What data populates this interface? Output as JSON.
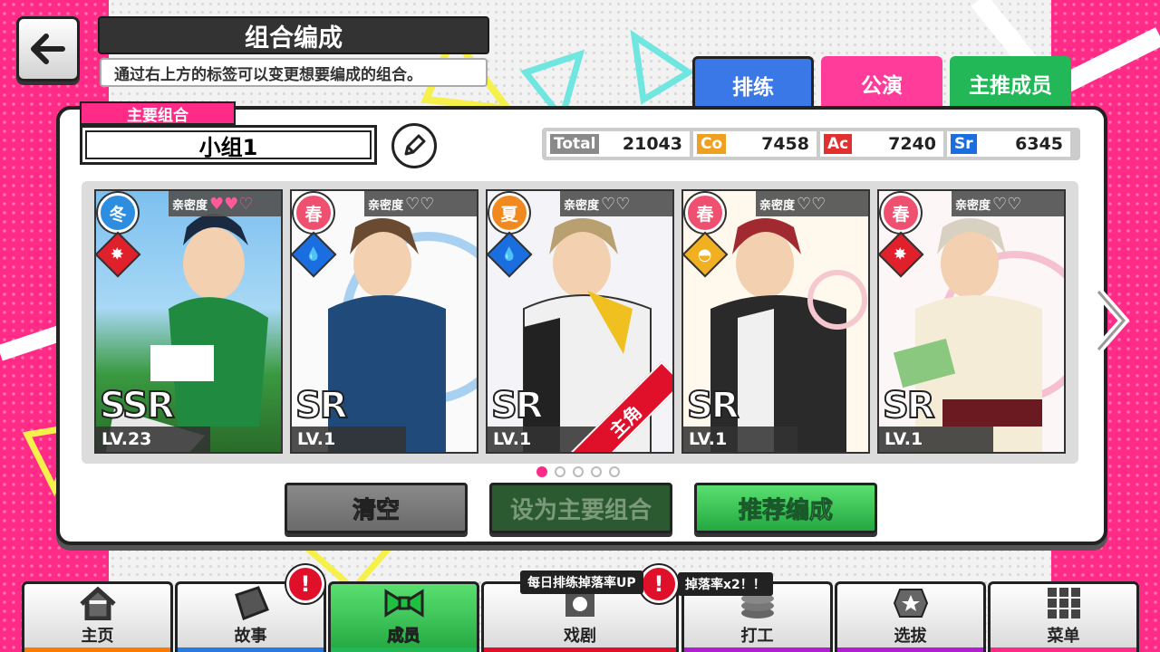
{
  "header": {
    "title": "组合编成",
    "subtitle": "通过右上方的标签可以变更想要编成的组合。"
  },
  "tabs": [
    {
      "label": "排练",
      "color": "#3a78e8"
    },
    {
      "label": "公演",
      "color": "#ff3c9a"
    },
    {
      "label": "主推成员",
      "color": "#22b857"
    }
  ],
  "group": {
    "section_label": "主要组合",
    "name": "小组1"
  },
  "stats": {
    "total_label": "Total",
    "total": "21043",
    "co_label": "Co",
    "co": "7458",
    "ac_label": "Ac",
    "ac": "7240",
    "sr_label": "Sr",
    "sr": "6345"
  },
  "affinity_label": "亲密度",
  "cards": [
    {
      "season": "冬",
      "season_color": "#2d8ee0",
      "attr": "✸",
      "attr_color": "#e0202a",
      "rarity": "SSR",
      "level": "LV.23",
      "hearts": "♥♥♡"
    },
    {
      "season": "春",
      "season_color": "#f05070",
      "attr": "💧",
      "attr_color": "#1a6ee0",
      "rarity": "SR",
      "level": "LV.1",
      "hearts": "♡♡"
    },
    {
      "season": "夏",
      "season_color": "#f08a20",
      "attr": "💧",
      "attr_color": "#1a6ee0",
      "rarity": "SR",
      "level": "LV.1",
      "hearts": "♡♡",
      "lead": "主角"
    },
    {
      "season": "春",
      "season_color": "#f05070",
      "attr": "◓",
      "attr_color": "#f0b020",
      "rarity": "SR",
      "level": "LV.1",
      "hearts": "♡♡"
    },
    {
      "season": "春",
      "season_color": "#f05070",
      "attr": "✸",
      "attr_color": "#e0202a",
      "rarity": "SR",
      "level": "LV.1",
      "hearts": "♡♡"
    }
  ],
  "actions": {
    "clear": "清空",
    "set_main": "设为主要组合",
    "recommend": "推荐编成"
  },
  "pagination": {
    "current": 1,
    "total": 5
  },
  "nav": [
    {
      "label": "主页",
      "icon": "house-icon",
      "color": "#ff7a00"
    },
    {
      "label": "故事",
      "icon": "book-icon",
      "color": "#2a7be0"
    },
    {
      "label": "成员",
      "icon": "bowtie-icon",
      "color": "#22b857"
    },
    {
      "label": "戏剧",
      "icon": "flower-icon",
      "color": "#e0102a"
    },
    {
      "label": "打工",
      "icon": "coins-icon",
      "color": "#b020d0"
    },
    {
      "label": "选拔",
      "icon": "star-badge-icon",
      "color": "#b020d0"
    },
    {
      "label": "菜单",
      "icon": "grid-icon",
      "color": "#ff2b86"
    }
  ],
  "notices": {
    "drama_tip": "每日排练掉落率UP",
    "work_tip": "掉落率x2！！"
  }
}
